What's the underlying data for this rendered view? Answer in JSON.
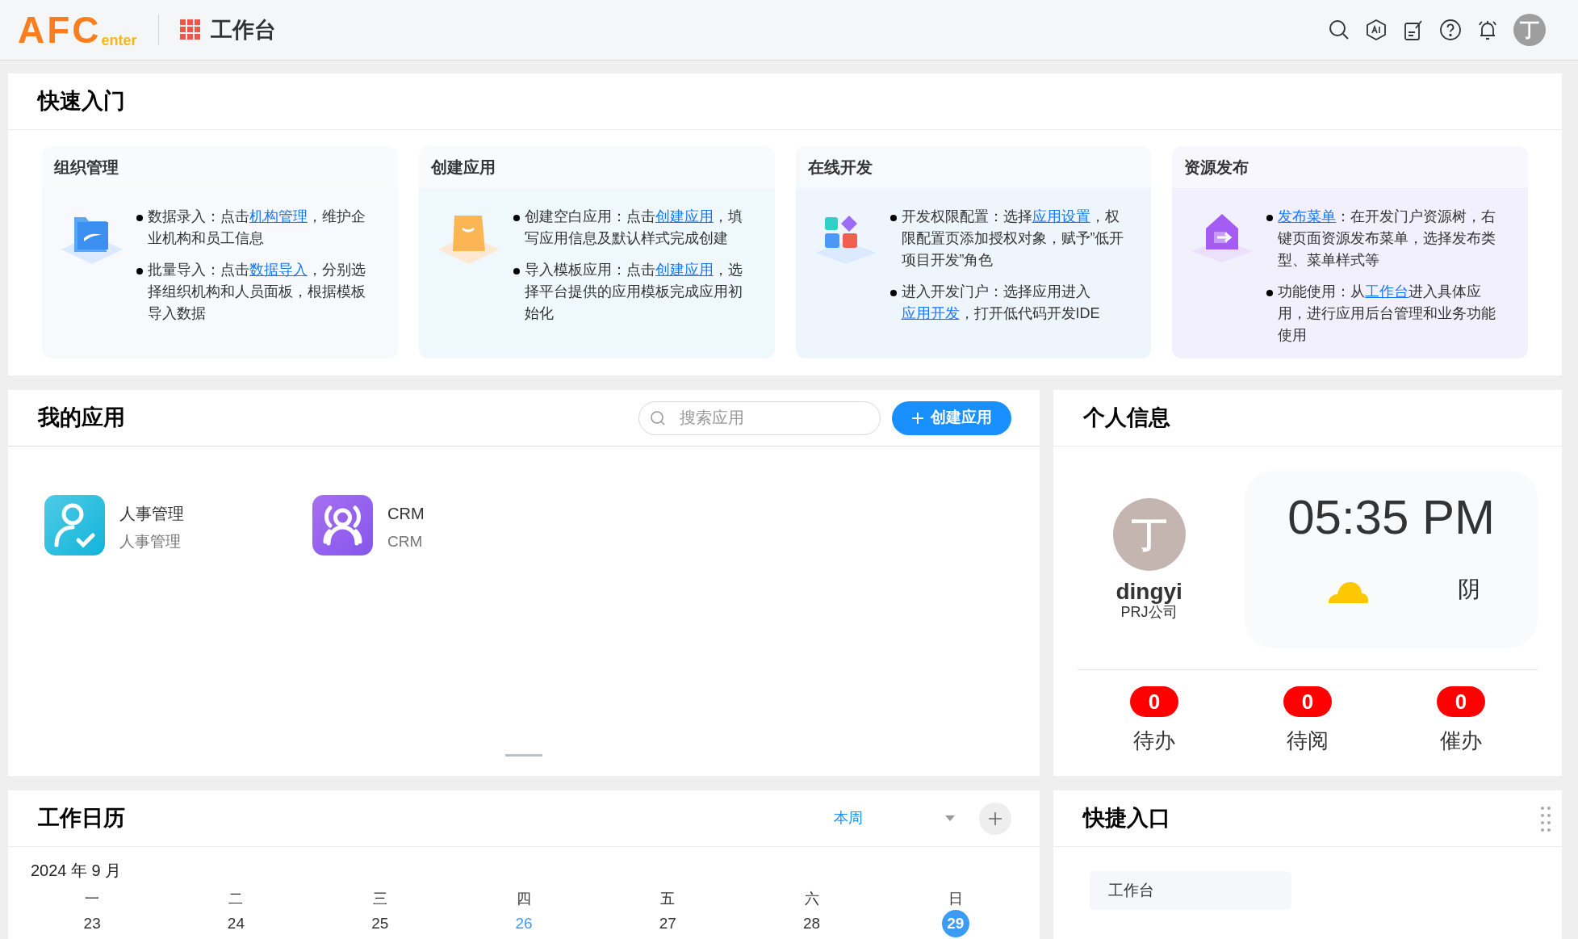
{
  "header": {
    "logo": {
      "main": "AFC",
      "sub": "enter"
    },
    "title": "工作台",
    "avatar": "丁"
  },
  "quick_start": {
    "title": "快速入门",
    "cards": [
      {
        "kind": "org",
        "title": "组织管理",
        "bullets": [
          [
            {
              "text": "数据录入：点击"
            },
            {
              "text": "机构管理",
              "link": true
            },
            {
              "text": "，维护企业机构和员工信息"
            }
          ],
          [
            {
              "text": "批量导入：点击"
            },
            {
              "text": "数据导入",
              "link": true
            },
            {
              "text": "，分别选择组织机构和人员面板，根据模板导入数据"
            }
          ]
        ]
      },
      {
        "kind": "app",
        "title": "创建应用",
        "bullets": [
          [
            {
              "text": "创建空白应用：点击"
            },
            {
              "text": "创建应用",
              "link": true
            },
            {
              "text": "，填写应用信息及默认样式完成创建"
            }
          ],
          [
            {
              "text": "导入模板应用：点击"
            },
            {
              "text": "创建应用",
              "link": true
            },
            {
              "text": "，选择平台提供的应用模板完成应用初始化"
            }
          ]
        ]
      },
      {
        "kind": "dev",
        "title": "在线开发",
        "bullets": [
          [
            {
              "text": "开发权限配置：选择"
            },
            {
              "text": "应用设置",
              "link": true
            },
            {
              "text": "，权限配置页添加授权对象，赋予”低开项目开发”角色"
            }
          ],
          [
            {
              "text": "进入开发门户：选择应用进入"
            },
            {
              "text": "应用开发",
              "link": true
            },
            {
              "text": "，打开低代码开发IDE"
            }
          ]
        ]
      },
      {
        "kind": "publish",
        "title": "资源发布",
        "bullets": [
          [
            {
              "text": "发布菜单",
              "link": true
            },
            {
              "text": "：在开发门户资源树，右键页面资源发布菜单，选择发布类型、菜单样式等"
            }
          ],
          [
            {
              "text": "功能使用：从"
            },
            {
              "text": "工作台",
              "link": true
            },
            {
              "text": "进入具体应用，进行应用后台管理和业务功能使用"
            }
          ]
        ]
      }
    ]
  },
  "my_apps": {
    "title": "我的应用",
    "search": {
      "placeholder": "搜索应用"
    },
    "create_button": "创建应用",
    "apps": [
      {
        "kind": "hr",
        "name": "人事管理",
        "subtitle": "人事管理"
      },
      {
        "kind": "crm",
        "name": "CRM",
        "subtitle": "CRM"
      }
    ]
  },
  "personal_info": {
    "title": "个人信息",
    "avatar": "丁",
    "name": "dingyi",
    "company": "PRJ公司",
    "time": "05:35 PM",
    "weather": "阴",
    "counts": [
      {
        "value": "0",
        "label": "待办"
      },
      {
        "value": "0",
        "label": "待阅"
      },
      {
        "value": "0",
        "label": "催办"
      }
    ]
  },
  "calendar": {
    "title": "工作日历",
    "range": "本周",
    "month": "2024 年 9 月",
    "days": [
      {
        "weekday": "一",
        "date": "23",
        "highlighted": false,
        "selected": false
      },
      {
        "weekday": "二",
        "date": "24",
        "highlighted": false,
        "selected": false
      },
      {
        "weekday": "三",
        "date": "25",
        "highlighted": false,
        "selected": false
      },
      {
        "weekday": "四",
        "date": "26",
        "highlighted": true,
        "selected": false
      },
      {
        "weekday": "五",
        "date": "27",
        "highlighted": false,
        "selected": false
      },
      {
        "weekday": "六",
        "date": "28",
        "highlighted": false,
        "selected": false
      },
      {
        "weekday": "日",
        "date": "29",
        "highlighted": false,
        "selected": true
      }
    ]
  },
  "shortcuts": {
    "title": "快捷入口",
    "items": [
      "工作台"
    ]
  }
}
